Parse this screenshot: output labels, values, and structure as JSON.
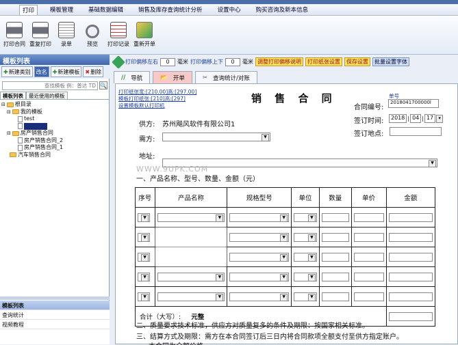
{
  "menu": {
    "items": [
      "打印",
      "模板管理",
      "基础数据编辑",
      "销售及库存查询统计分析",
      "设置中心",
      "购买咨询及新本信息"
    ],
    "active_index": 0
  },
  "toolbar": {
    "buttons": [
      {
        "label": "打印合同",
        "icon": "printer-icon"
      },
      {
        "label": "重复打印",
        "icon": "printer-repeat-icon"
      },
      {
        "label": "录单",
        "icon": "form-edit-icon"
      },
      {
        "label": "预览",
        "icon": "magnifier-icon"
      },
      {
        "label": "打印记录",
        "icon": "clipboard-icon"
      },
      {
        "label": "重新开单",
        "icon": "refresh-icon"
      }
    ]
  },
  "left_panel": {
    "title": "模板列表",
    "buttons": [
      "新建类别",
      "改名",
      "新建模板",
      "删除"
    ],
    "search_placeholder": "查找模板 例：普达 TD",
    "tabs": [
      "模板列表",
      "最近使用的模板"
    ],
    "tree": [
      {
        "label": "根目录",
        "level": 0,
        "type": "folder"
      },
      {
        "label": "我的模板",
        "level": 1,
        "type": "folder"
      },
      {
        "label": "test",
        "level": 2,
        "type": "doc"
      },
      {
        "label": "销售合同",
        "level": 2,
        "type": "doc",
        "selected": true
      },
      {
        "label": "房产销售合同",
        "level": 1,
        "type": "folder"
      },
      {
        "label": "房产销售合同_2",
        "level": 2,
        "type": "doc"
      },
      {
        "label": "房产销售合同_1",
        "level": 2,
        "type": "doc"
      },
      {
        "label": "汽车销售合同",
        "level": 1,
        "type": "folder"
      }
    ],
    "nav": [
      "模板列表",
      "查询统计",
      "视频教程"
    ]
  },
  "controls": {
    "offset_lr_label": "打印偏移左右",
    "offset_lr_value": "0",
    "unit1": "毫米",
    "offset_ud_label": "打印偏移上下",
    "offset_ud_value": "0",
    "unit2": "毫米",
    "btn_offset_help": "调整打印偏移说明",
    "btn_paper": "打印纸张设置",
    "btn_save": "保存设置",
    "btn_font": "批量设置字体"
  },
  "tabs": [
    "导航",
    "开单",
    "查询统计/对账"
  ],
  "document": {
    "link1": "打印纸张宽:[210.00]高:[297.00]",
    "link2": "模板打印纸张:[210]高:[297]",
    "link3": "设置模板默认打印机",
    "title": "销 售 合 同",
    "number_caption": "单号",
    "contract_no_label": "合同编号:",
    "contract_no": "2018041700000l",
    "sign_time_label": "签订时间:",
    "sign_year": "2018",
    "sign_month": "04",
    "sign_day": "17",
    "sign_place_label": "签订地点:",
    "supplier_label": "供方:",
    "supplier": "苏州飚风软件有限公司1",
    "buyer_label": "需方:",
    "address_label": "地址:",
    "watermark": "WWW.9UPK.COM",
    "section1": "一、产品名称、型号、数量、金额（元）",
    "columns": [
      "序号",
      "产品名称",
      "规格型号",
      "单位",
      "数量",
      "单价",
      "金额"
    ],
    "total_label": "合计（大写）:",
    "total_value": "元整",
    "section2": "二、质量要求技术标准，供应方对质量复多的条件及期限：按国家相关标准。",
    "section3": "三、结算方式及期限：需方在本合同签订后三日内将合同款项全额支付至供方指定账户。",
    "section3b": "本合同为全额价格"
  }
}
